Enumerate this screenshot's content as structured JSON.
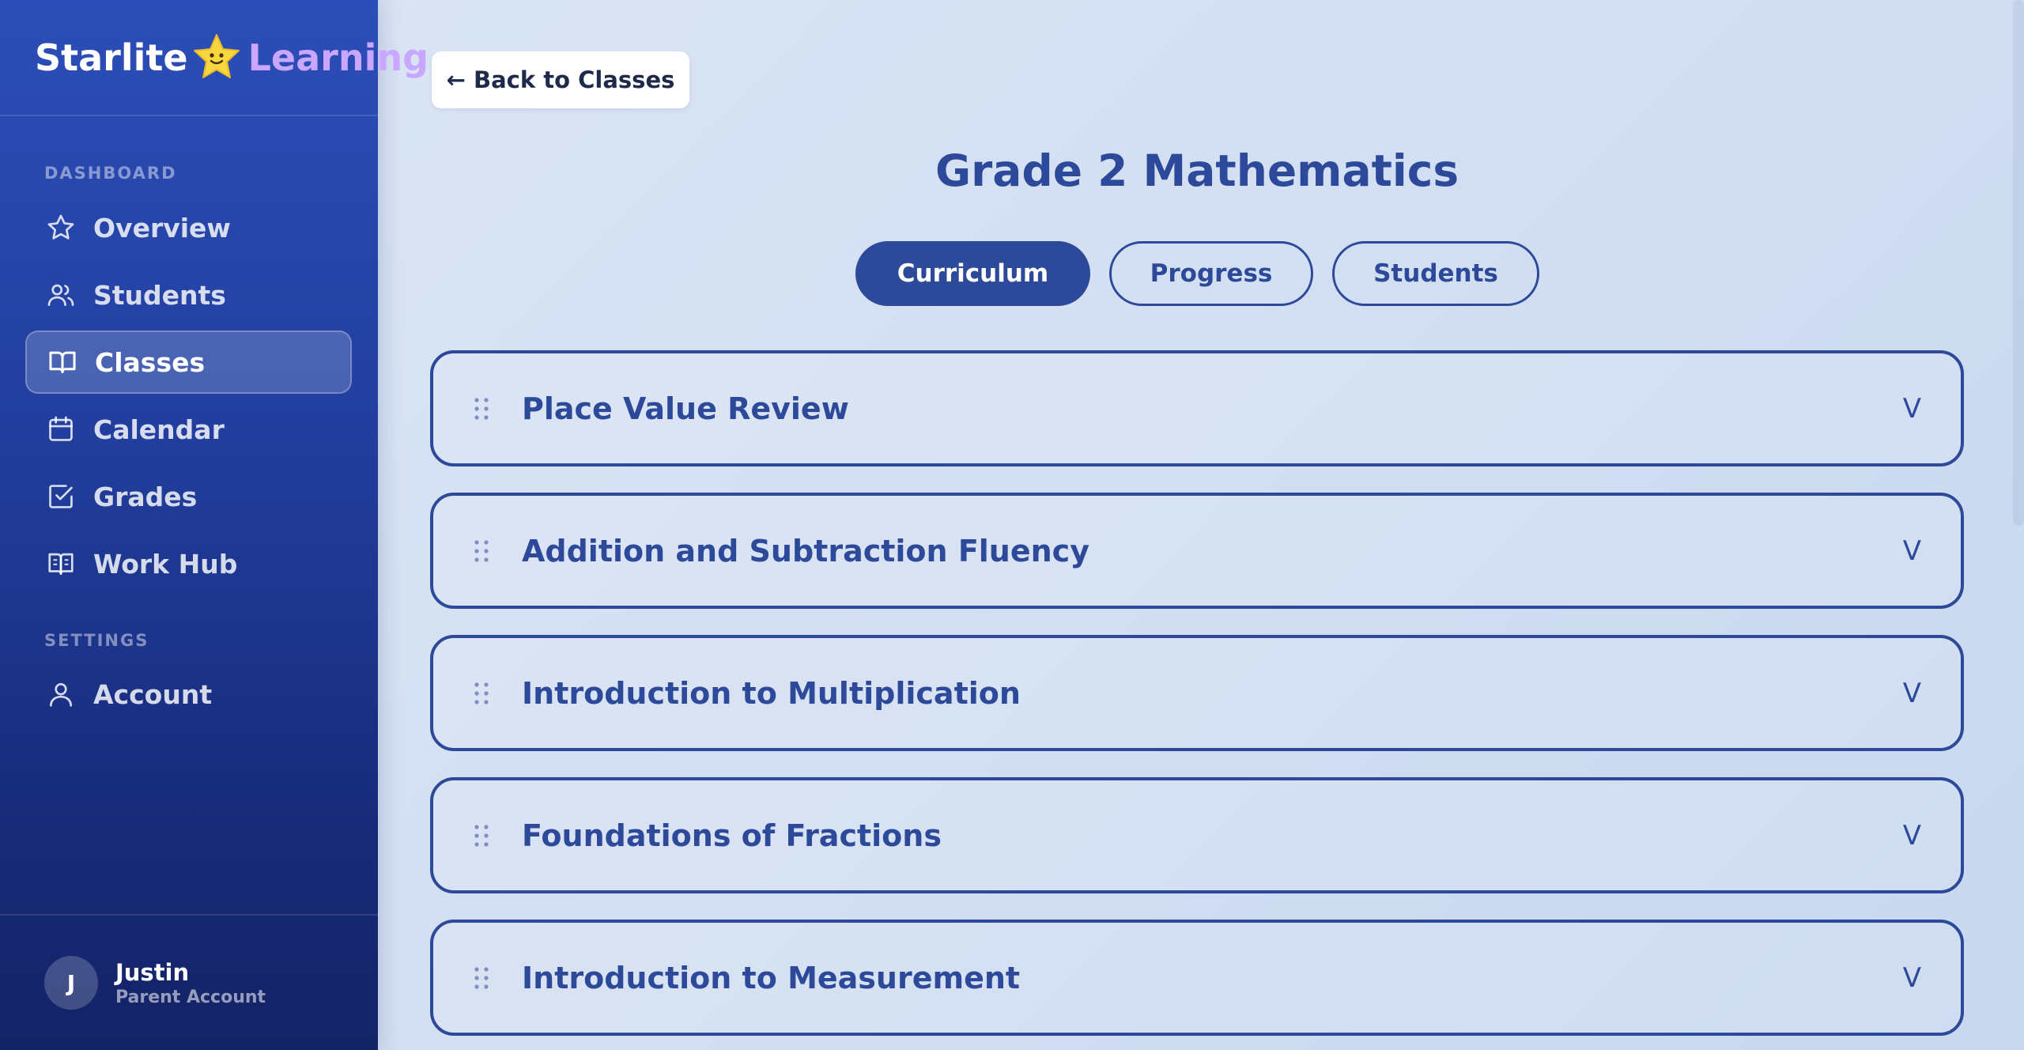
{
  "brand": {
    "part1": "Starlite",
    "part2": "Learning"
  },
  "sidebar": {
    "sections": [
      {
        "title": "DASHBOARD"
      },
      {
        "title": "SETTINGS"
      }
    ],
    "items": [
      {
        "label": "Overview",
        "icon": "star-icon"
      },
      {
        "label": "Students",
        "icon": "users-icon"
      },
      {
        "label": "Classes",
        "icon": "book-icon",
        "active": true
      },
      {
        "label": "Calendar",
        "icon": "calendar-icon"
      },
      {
        "label": "Grades",
        "icon": "check-square-icon"
      },
      {
        "label": "Work Hub",
        "icon": "open-book-icon"
      },
      {
        "label": "Account",
        "icon": "user-icon"
      }
    ],
    "user": {
      "initial": "J",
      "name": "Justin",
      "role": "Parent Account"
    }
  },
  "main": {
    "back_label": "← Back to Classes",
    "title": "Grade 2 Mathematics",
    "tabs": [
      {
        "label": "Curriculum",
        "active": true
      },
      {
        "label": "Progress"
      },
      {
        "label": "Students"
      }
    ],
    "modules": [
      {
        "title": "Place Value Review",
        "chevron": "V"
      },
      {
        "title": "Addition and Subtraction Fluency",
        "chevron": "V"
      },
      {
        "title": "Introduction to Multiplication",
        "chevron": "V"
      },
      {
        "title": "Foundations of Fractions",
        "chevron": "V"
      },
      {
        "title": "Introduction to Measurement",
        "chevron": "V"
      }
    ]
  },
  "colors": {
    "accent": "#2d4a9a",
    "sidebar_top": "#2c4eb8",
    "sidebar_bottom": "#142366",
    "brand_accent": "#c9a7ff",
    "star": "#f7d63e"
  }
}
